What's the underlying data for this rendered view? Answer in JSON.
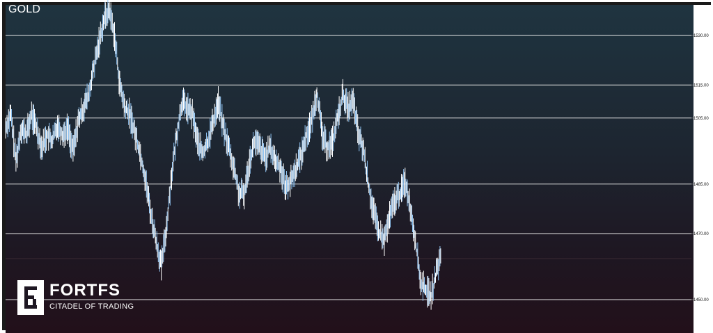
{
  "symbol": "GOLD",
  "brand": {
    "name": "FORTFS",
    "tagline": "CITADEL OF TRADING"
  },
  "colors": {
    "candle": "#8fc3f2",
    "level_line": "#e6e6e6",
    "axis_text": "#111111"
  },
  "chart_data": {
    "type": "line",
    "title": "GOLD",
    "ylim": [
      1444,
      1540
    ],
    "levels": [
      {
        "value": 1530,
        "label": "1530.00"
      },
      {
        "value": 1515,
        "label": "1515.00"
      },
      {
        "value": 1505,
        "label": "1505.00"
      },
      {
        "value": 1485,
        "label": "1485.00"
      },
      {
        "value": 1470,
        "label": "1470.00"
      },
      {
        "value": 1450,
        "label": "1450.00"
      }
    ],
    "series": [
      {
        "values": [
          1502,
          1506,
          1492,
          1502,
          1500,
          1506,
          1502,
          1496,
          1500,
          1498,
          1503,
          1500,
          1502,
          1495,
          1504,
          1508,
          1512,
          1520,
          1528,
          1535,
          1538,
          1530,
          1515,
          1508,
          1506,
          1500,
          1494,
          1486,
          1476,
          1468,
          1460,
          1472,
          1488,
          1500,
          1510,
          1508,
          1506,
          1498,
          1494,
          1498,
          1504,
          1510,
          1502,
          1496,
          1490,
          1482,
          1482,
          1492,
          1498,
          1496,
          1493,
          1496,
          1492,
          1490,
          1484,
          1486,
          1490,
          1494,
          1500,
          1504,
          1513,
          1500,
          1496,
          1498,
          1505,
          1512,
          1508,
          1510,
          1500,
          1495,
          1484,
          1476,
          1470,
          1468,
          1475,
          1480,
          1482,
          1486,
          1478,
          1468,
          1455,
          1453,
          1451,
          1458,
          1464
        ]
      }
    ]
  }
}
